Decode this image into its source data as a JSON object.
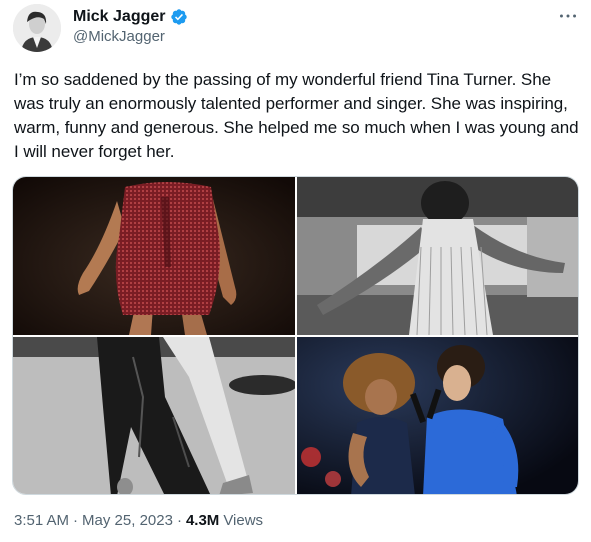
{
  "author": {
    "display_name": "Mick Jagger",
    "handle": "@MickJagger",
    "verified": true,
    "verified_color": "#1d9bf0"
  },
  "tweet": {
    "text": "I’m so saddened by the passing of my wonderful friend Tina Turner. She was truly an enormously talented performer and singer. She was inspiring, warm, funny and generous. She helped me so much when I was young and I will never forget her."
  },
  "media": [
    {
      "name": "photo-red-sequin-dress",
      "kind": "color"
    },
    {
      "name": "photo-silver-fringe-dress",
      "kind": "black-and-white"
    },
    {
      "name": "photo-leather-pants-legs",
      "kind": "black-and-white"
    },
    {
      "name": "photo-duet-on-stage",
      "kind": "color"
    }
  ],
  "meta": {
    "time": "3:51 AM",
    "separator_1": "·",
    "date": "May 25, 2023",
    "separator_2": "·",
    "views_count": "4.3M",
    "views_label": "Views"
  },
  "icons": {
    "more": "more-horizontal-icon",
    "verified": "verified-badge-icon"
  },
  "colors": {
    "text_primary": "#0f1419",
    "text_secondary": "#536471",
    "border": "#cfd9de"
  }
}
